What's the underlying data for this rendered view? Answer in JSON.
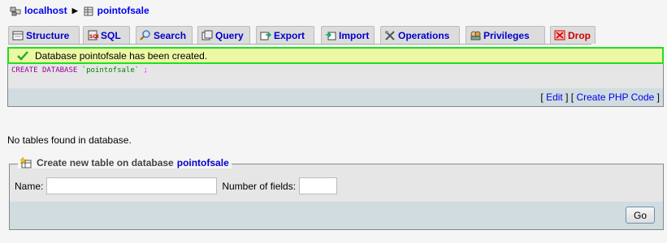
{
  "breadcrumb": {
    "server": "localhost",
    "database": "pointofsale"
  },
  "tabs": [
    {
      "label": "Structure",
      "icon": "structure-icon"
    },
    {
      "label": "SQL",
      "icon": "sql-icon"
    },
    {
      "label": "Search",
      "icon": "search-icon"
    },
    {
      "label": "Query",
      "icon": "query-icon"
    },
    {
      "label": "Export",
      "icon": "export-icon"
    },
    {
      "label": "Import",
      "icon": "import-icon"
    },
    {
      "label": "Operations",
      "icon": "operations-icon"
    },
    {
      "label": "Privileges",
      "icon": "privileges-icon"
    },
    {
      "label": "Drop",
      "icon": "drop-icon"
    }
  ],
  "notice": {
    "message": "Database pointofsale has been created."
  },
  "sql": {
    "kw1": "CREATE",
    "kw2": "DATABASE",
    "name": "`pointofsale`",
    "end": ";",
    "edit_label": "Edit",
    "php_label": "Create PHP Code",
    "open_bracket": "[",
    "close_bracket": "]",
    "mid": "] ["
  },
  "status": {
    "no_tables": "No tables found in database."
  },
  "create_table": {
    "legend_prefix": "Create new table on database",
    "database": "pointofsale",
    "name_label": "Name:",
    "name_value": "",
    "fields_label": "Number of fields:",
    "fields_value": "",
    "go_label": "Go"
  },
  "colors": {
    "notice_border": "#22dd22",
    "notice_bg": "#ebf8a4",
    "link": "#0000cc",
    "drop": "#cc0000",
    "bar": "#d0dce0"
  }
}
